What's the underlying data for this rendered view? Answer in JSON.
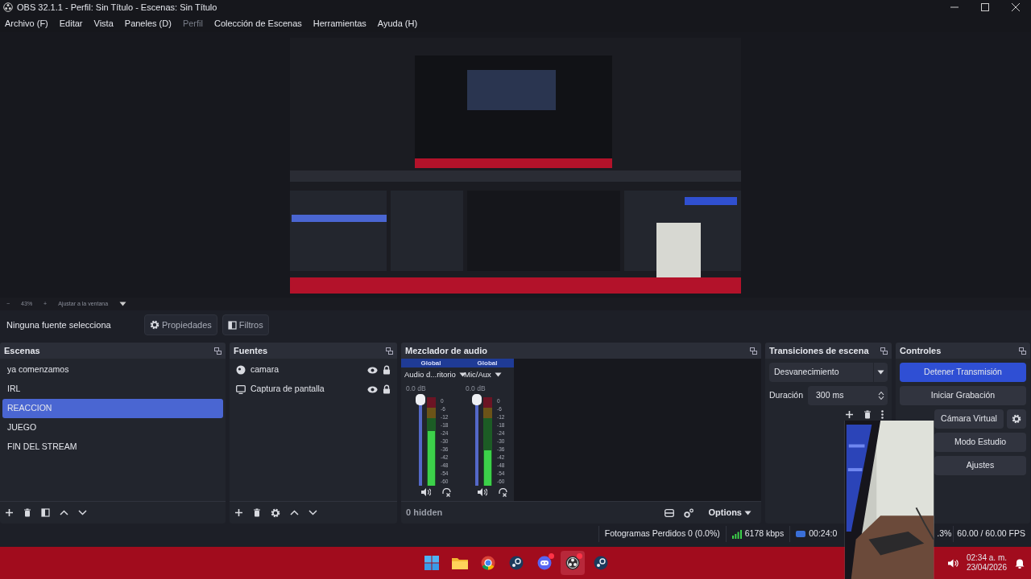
{
  "window": {
    "title": "OBS 32.1.1 - Perfil: Sin Título - Escenas: Sin Título"
  },
  "menu": [
    {
      "label": "Archivo (F)",
      "disabled": false
    },
    {
      "label": "Editar",
      "disabled": false
    },
    {
      "label": "Vista",
      "disabled": false
    },
    {
      "label": "Paneles (D)",
      "disabled": false
    },
    {
      "label": "Perfil",
      "disabled": true
    },
    {
      "label": "Colección de Escenas",
      "disabled": false
    },
    {
      "label": "Herramientas",
      "disabled": false
    },
    {
      "label": "Ayuda (H)",
      "disabled": false
    }
  ],
  "zoom_bar": {
    "minus": "−",
    "zoom": "43%",
    "plus": "+",
    "fit": "Ajustar a la ventana"
  },
  "context_bar": {
    "status": "Ninguna fuente selecciona",
    "buttons": [
      {
        "label": "Propiedades",
        "kind": "gear"
      },
      {
        "label": "Filtros",
        "kind": "filter"
      }
    ]
  },
  "scenes": {
    "title": "Escenas",
    "items": [
      {
        "label": "ya comenzamos",
        "selected": false
      },
      {
        "label": "IRL",
        "selected": false
      },
      {
        "label": "REACCION",
        "selected": true
      },
      {
        "label": "JUEGO",
        "selected": false
      },
      {
        "label": "FIN DEL STREAM",
        "selected": false
      }
    ]
  },
  "sources": {
    "title": "Fuentes",
    "items": [
      {
        "label": "camara",
        "kind": "camera",
        "visible": true,
        "locked": true
      },
      {
        "label": "Captura de pantalla",
        "kind": "display",
        "visible": true,
        "locked": true
      }
    ]
  },
  "mixer": {
    "title": "Mezclador de audio",
    "channels": [
      {
        "group": "Global",
        "name": "Audio d...ritorio",
        "reading": "0.0 dB",
        "fader": {
          "level": 1
        },
        "meter": {
          "level": 0.62
        },
        "scale": [
          "0",
          "-6",
          "-12",
          "-18",
          "-24",
          "-30",
          "-36",
          "-42",
          "-48",
          "-54",
          "-60"
        ]
      },
      {
        "group": "Global",
        "name": "Mic/Aux",
        "reading": "0.0 dB",
        "fader": {
          "level": 1
        },
        "meter": {
          "level": 0.4
        },
        "scale": [
          "0",
          "-6",
          "-12",
          "-18",
          "-24",
          "-30",
          "-36",
          "-42",
          "-48",
          "-54",
          "-60"
        ]
      }
    ],
    "hidden": "0 hidden",
    "options": "Options"
  },
  "transitions": {
    "title": "Transiciones de escena",
    "transition": "Desvanecimiento",
    "duration_label": "Duración",
    "duration": "300 ms"
  },
  "controls": {
    "title": "Controles",
    "buttons": [
      {
        "label": "Detener Transmisión",
        "active": true,
        "settings": false
      },
      {
        "label": "Iniciar Grabación",
        "active": false,
        "settings": false
      },
      {
        "label": "Cámara Virtual",
        "active": false,
        "settings": true
      },
      {
        "label": "Modo Estudio",
        "active": false,
        "settings": false
      },
      {
        "label": "Ajustes",
        "active": false,
        "settings": false
      }
    ]
  },
  "status_bar": {
    "dropped": "Fotogramas Perdidos 0 (0.0%)",
    "bitrate": "6178 kbps",
    "time": "00:24:0",
    "cpu": ".3%",
    "fps": "60.00 / 60.00 FPS"
  },
  "taskbar": {
    "apps": [
      {
        "kind": "windows",
        "active": false,
        "notify": false
      },
      {
        "kind": "folder",
        "active": false,
        "notify": false
      },
      {
        "kind": "chrome",
        "active": false,
        "notify": false
      },
      {
        "kind": "steam",
        "active": false,
        "notify": false
      },
      {
        "kind": "discord",
        "active": false,
        "notify": true
      },
      {
        "kind": "obs",
        "active": true,
        "notify": true
      },
      {
        "kind": "steam",
        "active": false,
        "notify": false
      }
    ],
    "clock": "02:34 a. m.",
    "date": "23/04/2026"
  }
}
